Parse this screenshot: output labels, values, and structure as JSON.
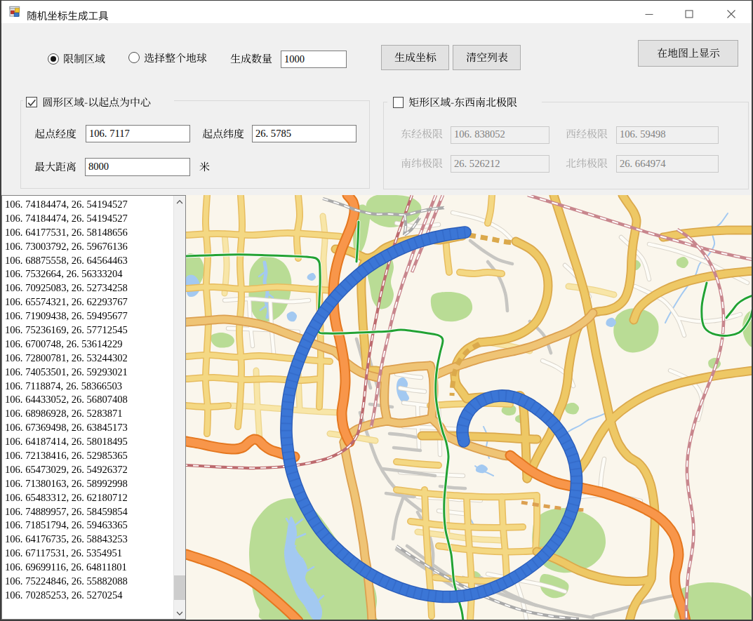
{
  "window": {
    "title": "随机坐标生成工具",
    "minimize_label": "最小化",
    "maximize_label": "最大化",
    "close_label": "关闭"
  },
  "toolbar": {
    "radio_limit_area": {
      "label": "限制区域",
      "checked": true
    },
    "radio_whole_earth": {
      "label": "选择整个地球",
      "checked": false
    },
    "count_label": "生成数量",
    "count_value": "1000",
    "generate_button": "生成坐标",
    "clear_button": "清空列表",
    "show_on_map_button": "在地图上显示"
  },
  "circle_group": {
    "title": "圆形区域-以起点为中心",
    "checked": true,
    "lon_label": "起点经度",
    "lon_value": "106.7117",
    "lat_label": "起点纬度",
    "lat_value": "26.5785",
    "dist_label": "最大距离",
    "dist_value": "8000",
    "dist_unit": "米"
  },
  "rect_group": {
    "title": "矩形区域-东西南北极限",
    "checked": false,
    "east_label": "东经极限",
    "east_value": "106.838052",
    "west_label": "西经极限",
    "west_value": "106.59498",
    "south_label": "南纬极限",
    "south_value": "26.526212",
    "north_label": "北纬极限",
    "north_value": "26.664974"
  },
  "coordinate_list": {
    "items": [
      "106.74184474,26.54194527",
      "106.74184474,26.54194527",
      "106.64177531,26.58148656",
      "106.73003792,26.59676136",
      "106.68875558,26.64564463",
      "106.7532664,26.56333204",
      "106.70925083,26.52734258",
      "106.65574321,26.62293767",
      "106.71909438,26.59495677",
      "106.75236169,26.57712545",
      "106.6700748,26.53614229",
      "106.72800781,26.53244302",
      "106.74053501,26.59293021",
      "106.7118874,26.58366503",
      "106.64433052,26.56807408",
      "106.68986928,26.5283871",
      "106.67369498,26.63845173",
      "106.64187414,26.58018495",
      "106.72138416,26.52985365",
      "106.65473029,26.54926372",
      "106.71380163,26.58992998",
      "106.65483312,26.62180712",
      "106.74889957,26.58459854",
      "106.71851794,26.59463365",
      "106.64176735,26.58843253",
      "106.67117531,26.5354951",
      "106.69699116,26.64811801",
      "106.75224846,26.55882088",
      "106.70285253,26.5270254"
    ]
  },
  "map": {
    "palette": {
      "background": "#FAF6EC",
      "park": "#B9DC95",
      "water": "#A3C9F1",
      "minor_casing": "#DAD5CB",
      "gray_road": "#C7C6C2",
      "pale_casing": "#EDD58D",
      "pale_fill": "#F8E6A8",
      "yellow_casing": "#E7BC5F",
      "yellow_fill": "#F4D883",
      "arterial_casing": "#DBA94C",
      "arterial_fill": "#EEC865",
      "trunk_casing": "#DCA050",
      "trunk_fill": "#EFC475",
      "motorway_casing": "#E4771F",
      "motorway_fill": "#F8964A",
      "railway_dark": "#BD6A6E",
      "railway_pink": "#C8868D",
      "green_route": "#23A233",
      "spiral_fill": "#3B76D6",
      "spiral_edge": "#2A5CB8"
    }
  }
}
